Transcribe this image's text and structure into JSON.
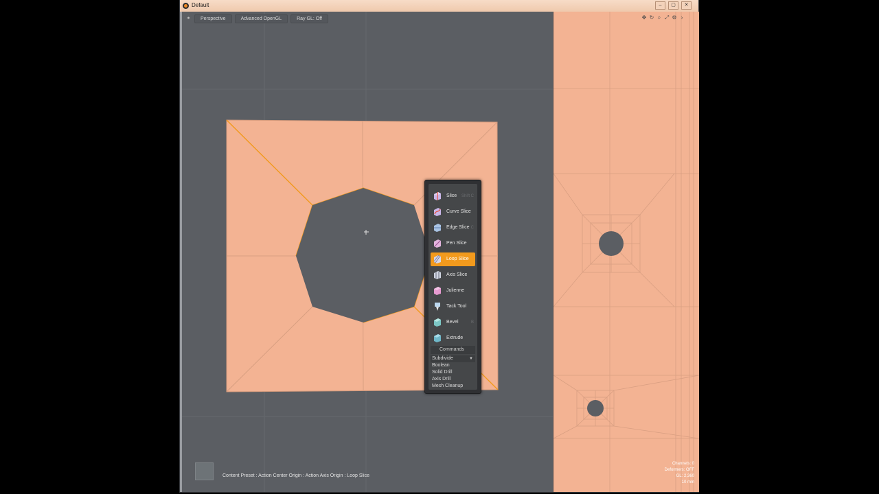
{
  "window": {
    "title": "Default",
    "buttons": [
      "–",
      "▢",
      "✕"
    ]
  },
  "viewport": {
    "toolbar": [
      "Perspective",
      "Advanced OpenGL",
      "Ray GL: Off"
    ],
    "status": "Content Preset : Action Center Origin : Action Axis Origin : Loop Slice"
  },
  "side_view": {
    "nav_icons": [
      "move-icon",
      "rotate-icon",
      "zoom-icon",
      "fit-icon",
      "settings-icon",
      "arrow-icon"
    ],
    "readout": [
      "Channels: 0",
      "Deformers: OFF",
      "GL: 2,360",
      "10 mm"
    ]
  },
  "pie_menu": {
    "tools": [
      {
        "label": "Slice",
        "shortcut": "Shift C",
        "icon": "slice-icon"
      },
      {
        "label": "Curve Slice",
        "shortcut": "",
        "icon": "curve-slice-icon"
      },
      {
        "label": "Edge Slice",
        "shortcut": "C",
        "icon": "edge-slice-icon"
      },
      {
        "label": "Pen Slice",
        "shortcut": "",
        "icon": "pen-slice-icon"
      },
      {
        "label": "Loop Slice",
        "shortcut": "",
        "icon": "loop-slice-icon",
        "active": true
      },
      {
        "label": "Axis Slice",
        "shortcut": "",
        "icon": "axis-slice-icon"
      },
      {
        "label": "Julienne",
        "shortcut": "",
        "icon": "julienne-icon"
      },
      {
        "label": "Tack Tool",
        "shortcut": "",
        "icon": "tack-tool-icon"
      },
      {
        "label": "Bevel",
        "shortcut": "B",
        "icon": "bevel-icon"
      },
      {
        "label": "Extrude",
        "shortcut": "",
        "icon": "extrude-icon"
      }
    ],
    "commands_title": "Commands",
    "commands": [
      "Subdivide",
      "Boolean",
      "Solid Drill",
      "Axis Drill",
      "Mesh Cleanup"
    ]
  },
  "colors": {
    "mesh": "#f3b393",
    "viewport": "#5b5e63",
    "accent": "#f29a1d"
  }
}
